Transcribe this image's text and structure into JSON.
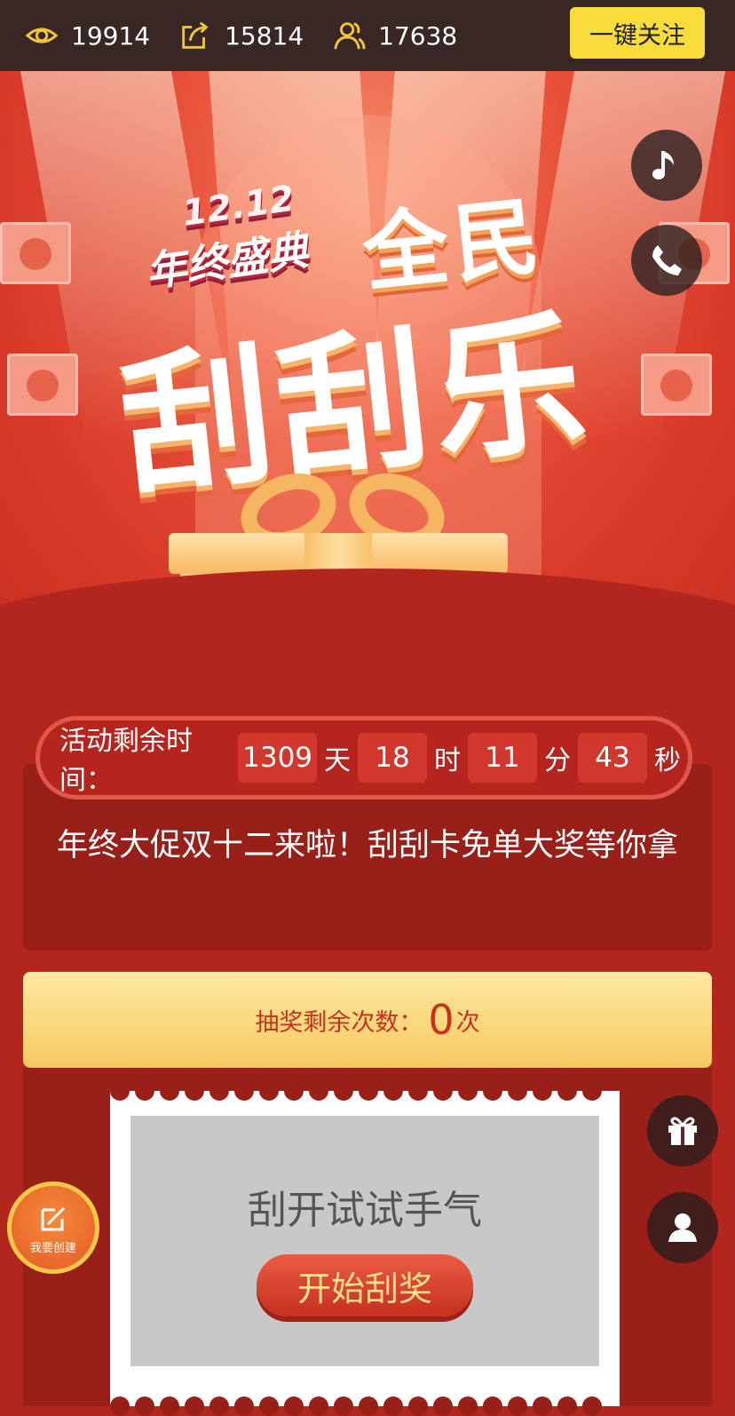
{
  "stats": {
    "views": "19914",
    "shares": "15814",
    "participants": "17638"
  },
  "follow_label": "一键关注",
  "hero": {
    "badge_top": "12.12",
    "badge_bottom": "年终盛典",
    "title_line1": "全民",
    "title_line2": "刮刮乐"
  },
  "countdown": {
    "label": "活动剩余时间：",
    "days": "1309",
    "days_unit": "天",
    "hours": "18",
    "hours_unit": "时",
    "minutes": "11",
    "minutes_unit": "分",
    "seconds": "43",
    "seconds_unit": "秒"
  },
  "promo_text": "年终大促双十二来啦！刮刮卡免单大奖等你拿",
  "draws": {
    "label": "抽奖剩余次数：",
    "count": "0",
    "unit": "次"
  },
  "scratch": {
    "hint": "刮开试试手气",
    "button": "开始刮奖"
  },
  "create_label": "我要创建",
  "icons": {
    "views": "eye-icon",
    "shares": "share-icon",
    "participants": "users-icon",
    "music": "music-note-icon",
    "phone": "phone-icon",
    "gift": "gift-icon",
    "profile": "user-icon",
    "create": "edit-icon"
  },
  "colors": {
    "accent_yellow": "#f7dc3c",
    "page_red": "#b3261e",
    "panel_dark_red": "#982019"
  }
}
